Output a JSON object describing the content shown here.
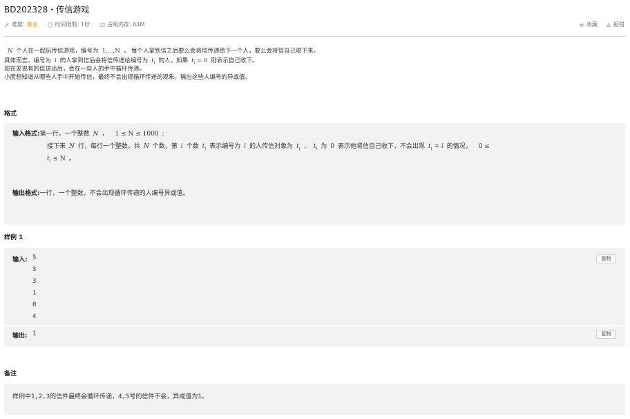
{
  "problem": {
    "title": "BD202328・传信游戏",
    "difficulty_label": "难度:",
    "difficulty_value": "黄金",
    "time_limit": "时间限制: 1秒",
    "memory_limit": "占用内存: 64M",
    "favorite_label": "收藏",
    "report_label": "报错"
  },
  "description": {
    "line1": {
      "a": "N",
      "b": "个人在一起玩传信游戏，编号为",
      "c": "1,...,N",
      "d": "，  每个人拿到信之后要么会将信传递给下一个人，要么会将信自己收下来。"
    },
    "line2": {
      "a": "具体而言，编号为",
      "b": "i",
      "c": "的人拿到信后会将信传递给编号为",
      "d": "t",
      "e": "i",
      "f": "的人，如果",
      "g": "t",
      "h": "i",
      "i": "= 0",
      "j": "则表示自己收下。"
    },
    "line3": "现在发现有的信送出后，会在一些人的手中循环传递。",
    "line4": "小度想知道从哪些人手中开始传信，最终不会出现循环传递的现象，输出这些人编号的异或值。"
  },
  "format": {
    "section_title": "格式",
    "input_label": "输入格式:",
    "input_line1": {
      "a": "第一行，一个整数",
      "b": "N",
      "c": "，",
      "d": "1 ≤ N ≤ 1000",
      "e": ";"
    },
    "input_line2": {
      "a": "接下来",
      "b": "N",
      "c": "行，每行一个整数，共",
      "d": "N",
      "e": "个数，第",
      "f": "i",
      "g": "个数",
      "h": "t",
      "h_sub": "i",
      "i": "表示编号为",
      "j": "i",
      "k": "的人传信对象为",
      "l": "t",
      "l_sub": "i",
      "m": "，",
      "n": "t",
      "n_sub": "i",
      "o": "为",
      "p": "0",
      "q": "表示他将信自己收下，不会出现",
      "r": "t",
      "r_sub": "i",
      "s": "= i",
      "t": "的情况，",
      "u": "0 ≤"
    },
    "input_line3": {
      "a": "t",
      "a_sub": "i",
      "b": "≤ N",
      "c": "。"
    },
    "output_label": "输出格式:",
    "output_text": "一行，一个整数，不会出现循环传递的人编号异或值。"
  },
  "sample": {
    "section_title": "样例 1",
    "input_label": "输入:",
    "input_values": [
      "5",
      "3",
      "3",
      "1",
      "0",
      "4"
    ],
    "output_label": "输出:",
    "output_value": "1",
    "copy_label": "复制"
  },
  "notes": {
    "section_title": "备注",
    "text": "样例中1,2,3的信件最终会循环传递，4,5号的信件不会，异或值为1。"
  },
  "colors": {
    "difficulty": "#e0a000",
    "panel_bg": "#f2f2f2",
    "divider": "#d6d6d6"
  }
}
